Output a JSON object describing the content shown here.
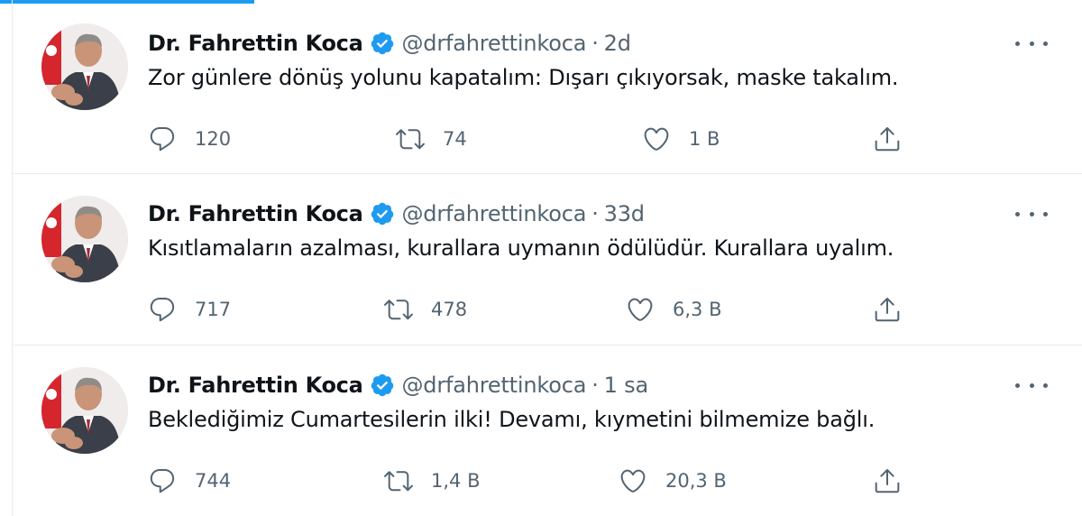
{
  "colors": {
    "accent": "#1d9bf0",
    "text": "#0f1419",
    "secondary": "#536471",
    "divider": "#e6ecf0"
  },
  "tweets": [
    {
      "author_name": "Dr. Fahrettin Koca",
      "handle": "@drfahrettinkoca",
      "time": "2d",
      "text": "Zor günlere dönüş yolunu kapatalım: Dışarı çıkıyorsak, maske takalım.",
      "replies": "120",
      "retweets": "74",
      "likes": "1 B"
    },
    {
      "author_name": "Dr. Fahrettin Koca",
      "handle": "@drfahrettinkoca",
      "time": "33d",
      "text": "Kısıtlamaların azalması, kurallara uymanın ödülüdür. Kurallara uyalım.",
      "replies": "717",
      "retweets": "478",
      "likes": "6,3 B"
    },
    {
      "author_name": "Dr. Fahrettin Koca",
      "handle": "@drfahrettinkoca",
      "time": "1 sa",
      "text": "Beklediğimiz Cumartesilerin ilki! Devamı, kıymetini bilmemize bağlı.",
      "replies": "744",
      "retweets": "1,4 B",
      "likes": "20,3 B"
    }
  ],
  "icons": {
    "verified": "verified-badge-icon",
    "more": "more-options-icon",
    "reply": "reply-icon",
    "retweet": "retweet-icon",
    "like": "heart-icon",
    "share": "share-icon"
  }
}
